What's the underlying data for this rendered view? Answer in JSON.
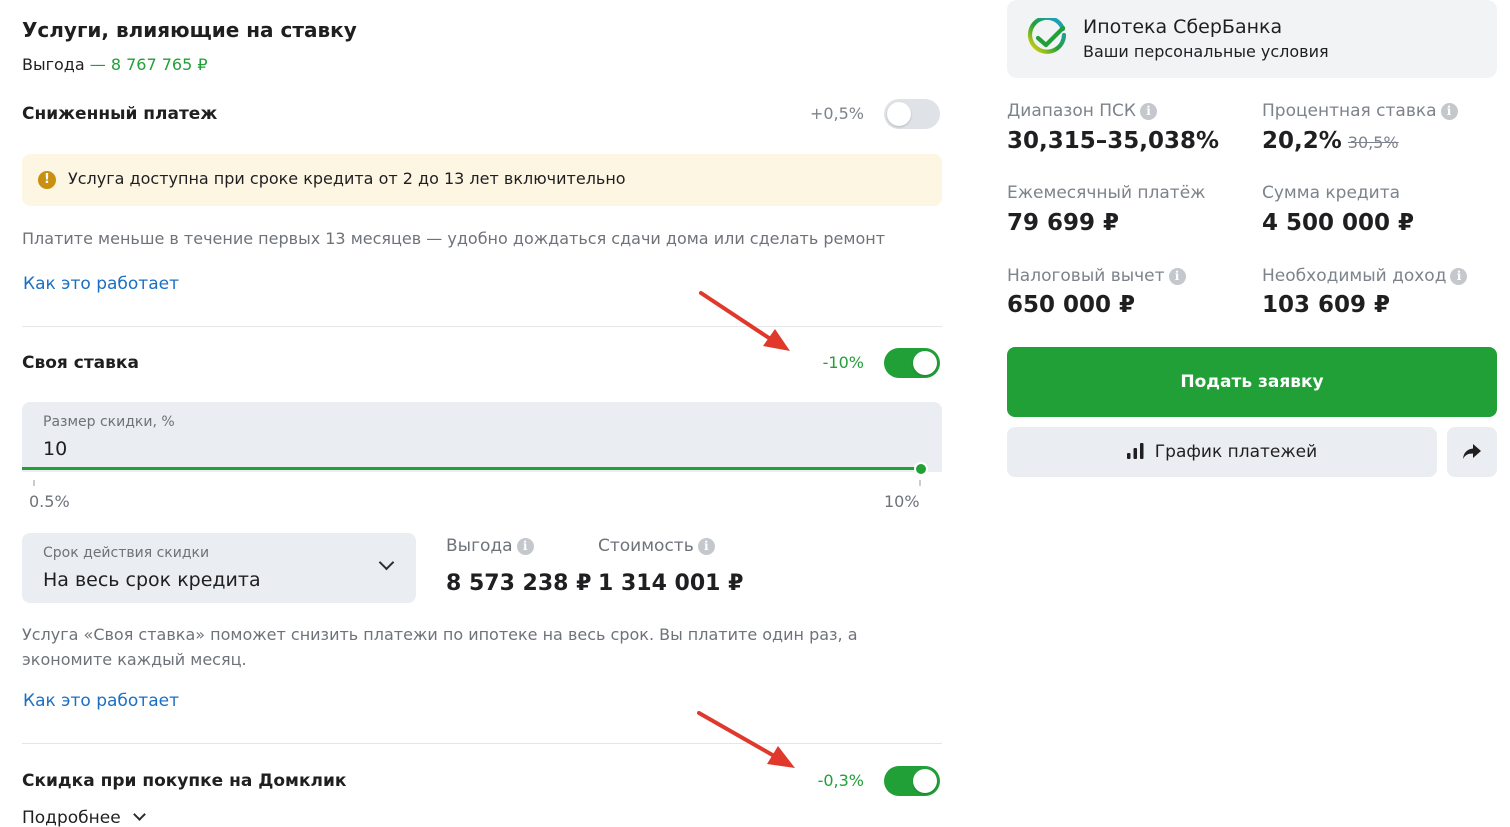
{
  "services": {
    "title": "Услуги, влияющие на ставку",
    "benefit_label": "Выгода",
    "benefit_value": "— 8 767 765 ₽"
  },
  "reduced_payment": {
    "name": "Сниженный платеж",
    "delta": "+0,5%",
    "enabled": false,
    "warning_text": "Услуга доступна при сроке кредита от 2 до 13 лет включительно",
    "description": "Платите меньше в течение первых 13 месяцев — удобно дождаться сдачи дома или сделать ремонт",
    "link": "Как это работает"
  },
  "own_rate": {
    "name": "Своя ставка",
    "delta": "-10%",
    "enabled": true,
    "discount_label": "Размер скидки, %",
    "discount_value": "10",
    "slider_min_label": "0.5%",
    "slider_max_label": "10%",
    "slider_fraction": 1.0,
    "period_label": "Срок действия скидки",
    "period_value": "На весь срок кредита",
    "benefit_label": "Выгода",
    "benefit_value": "8 573 238 ₽",
    "cost_label": "Стоимость",
    "cost_value": "1 314 001 ₽",
    "description_line1": "Услуга «Своя ставка» поможет снизить платежи по ипотеке на весь срок. Вы платите один раз, а",
    "description_line2": "экономите каждый месяц.",
    "link": "Как это работает"
  },
  "domclick": {
    "name": "Скидка при покупке на Домклик",
    "delta": "-0,3%",
    "enabled": true,
    "more_link": "Подробнее"
  },
  "summary": {
    "title": "Ипотека СберБанка",
    "subtitle": "Ваши персональные условия",
    "psk_label": "Диапазон ПСК",
    "psk_value": "30,315–35,038%",
    "rate_label": "Процентная ставка",
    "rate_value": "20,2%",
    "rate_old": "30,5%",
    "monthly_label": "Ежемесячный платёж",
    "monthly_value": "79 699 ₽",
    "loan_label": "Сумма кредита",
    "loan_value": "4 500 000 ₽",
    "tax_label": "Налоговый вычет",
    "tax_value": "650 000 ₽",
    "income_label": "Необходимый доход",
    "income_value": "103 609 ₽",
    "apply_button": "Подать заявку",
    "schedule_button": "График платежей"
  },
  "colors": {
    "accent_green": "#21a038",
    "link_blue": "#1a6fc4",
    "annotation_red": "#e0392c"
  },
  "icons": [
    "warning-icon",
    "info-icon",
    "chevron-down-icon",
    "sber-logo-icon",
    "bar-chart-icon",
    "share-icon"
  ]
}
